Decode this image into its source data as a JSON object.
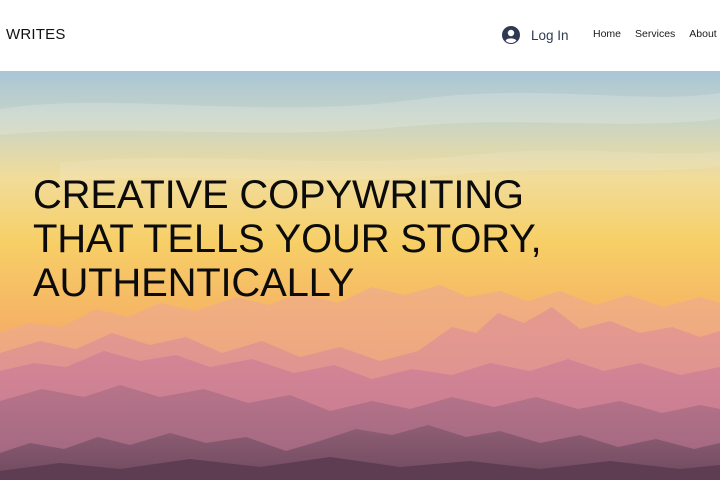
{
  "header": {
    "brand": "WRITES",
    "login_label": "Log In",
    "login_icon": "user-avatar-icon",
    "nav": [
      "Home",
      "Services",
      "About"
    ]
  },
  "hero": {
    "headline_lines": [
      "CREATIVE COPYWRITING",
      "THAT TELLS YOUR STORY,",
      "AUTHENTICALLY"
    ],
    "background": "sunset-mountains",
    "colors": {
      "sky_top": "#a8c7d9",
      "sky_mid": "#f6d47a",
      "sky_low": "#f5a55f",
      "mountains_far": "#e9a39a",
      "mountains_near": "#8e5d74"
    }
  }
}
